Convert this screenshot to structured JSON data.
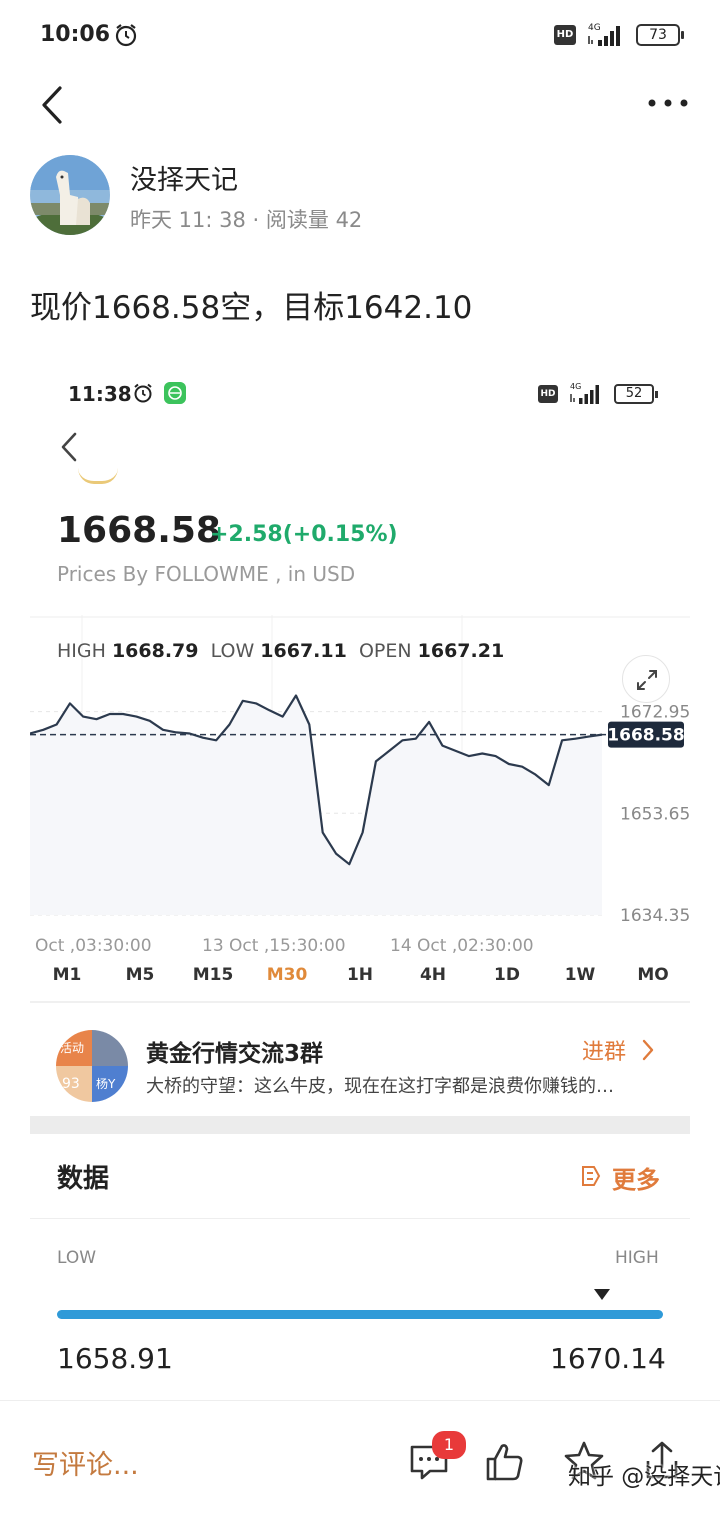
{
  "status_bar": {
    "time": "10:06",
    "network": "4G",
    "hd": "HD",
    "battery": "73"
  },
  "header": {
    "back_icon": "chevron-left-icon",
    "more_icon": "more-horizontal-icon"
  },
  "author": {
    "name": "没择天记",
    "meta": "昨天 11: 38 · 阅读量 42"
  },
  "post": {
    "text": "现价1668.58空，目标1642.10"
  },
  "embedded": {
    "status_bar": {
      "time": "11:38",
      "network": "4G",
      "hd": "HD",
      "battery": "52"
    },
    "price": "1668.58",
    "change": "+2.58(+0.15%)",
    "source": "Prices By FOLLOWME , in USD",
    "high_label": "HIGH",
    "high_value": "1668.79",
    "low_label": "LOW",
    "low_value": "1667.11",
    "open_label": "OPEN",
    "open_value": "1667.21",
    "timeframes": [
      "M1",
      "M5",
      "M15",
      "M30",
      "1H",
      "4H",
      "1D",
      "1W",
      "MO"
    ],
    "active_timeframe": "M30",
    "group": {
      "avatar_tag": "活动",
      "avatar_num": "93",
      "avatar_user": "杨Y",
      "name": "黄金行情交流3群",
      "message": "大桥的守望：这么牛皮，现在在这打字都是浪费你赚钱的…",
      "join": "进群"
    },
    "data_section": {
      "title": "数据",
      "more": "更多",
      "low_label": "LOW",
      "high_label": "HIGH",
      "low_value": "1658.91",
      "high_value": "1670.14",
      "marker_position": 0.9
    }
  },
  "chart_data": {
    "type": "line",
    "x_labels": [
      "Oct ,03:30:00",
      "13 Oct ,15:30:00",
      "14 Oct ,02:30:00"
    ],
    "y_ticks": [
      1672.95,
      1653.65,
      1634.35
    ],
    "ylim": [
      1634.35,
      1678.0
    ],
    "current_price": 1668.58,
    "series": [
      {
        "values": [
          1668.8,
          1669.5,
          1670.5,
          1674.5,
          1672.0,
          1671.5,
          1672.5,
          1672.5,
          1672.0,
          1671.2,
          1669.5,
          1669.0,
          1668.8,
          1668.0,
          1667.5,
          1670.5,
          1675.0,
          1674.5,
          1673.2,
          1672.0,
          1676.0,
          1670.5,
          1650.0,
          1646.0,
          1644.0,
          1650.0,
          1663.5,
          1665.5,
          1667.5,
          1667.8,
          1671.0,
          1666.5,
          1665.5,
          1664.5,
          1665.0,
          1664.5,
          1663.0,
          1662.5,
          1661.0,
          1659.0,
          1667.5,
          1667.8,
          1668.2,
          1668.58
        ]
      }
    ],
    "grid": true
  },
  "bottom_bar": {
    "comment_placeholder": "写评论...",
    "comment_badge": "1",
    "watermark": "知乎 @没择天记"
  }
}
